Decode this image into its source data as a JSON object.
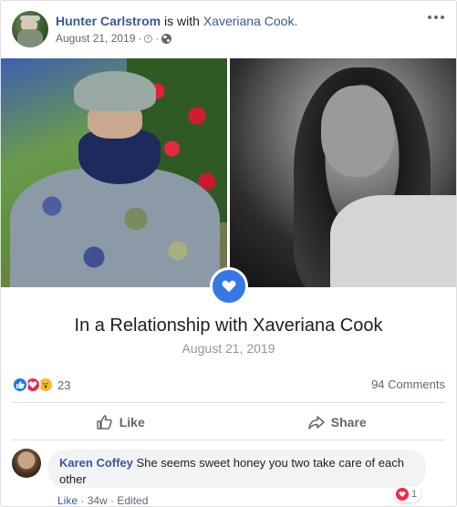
{
  "post": {
    "author": "Hunter Carlstrom",
    "with_text": " is with ",
    "tagged": "Xaveriana Cook.",
    "date": "August 21, 2019",
    "separator": " · "
  },
  "life_event": {
    "title": "In a Relationship with Xaveriana Cook",
    "date": "August 21, 2019"
  },
  "reactions": {
    "count": "23",
    "types": [
      "like",
      "love",
      "wow"
    ]
  },
  "comments_summary": "94 Comments",
  "actions": {
    "like_label": "Like",
    "share_label": "Share"
  },
  "comment": {
    "author": "Karen Coffey",
    "text": "She seems sweet honey you two take care of each other",
    "reaction_count": "1",
    "like_label": "Like",
    "time": "34w",
    "edited": "Edited",
    "dot": " · "
  },
  "colors": {
    "link_blue": "#385898",
    "accent_blue": "#3578e5",
    "love_red": "#f02849"
  }
}
